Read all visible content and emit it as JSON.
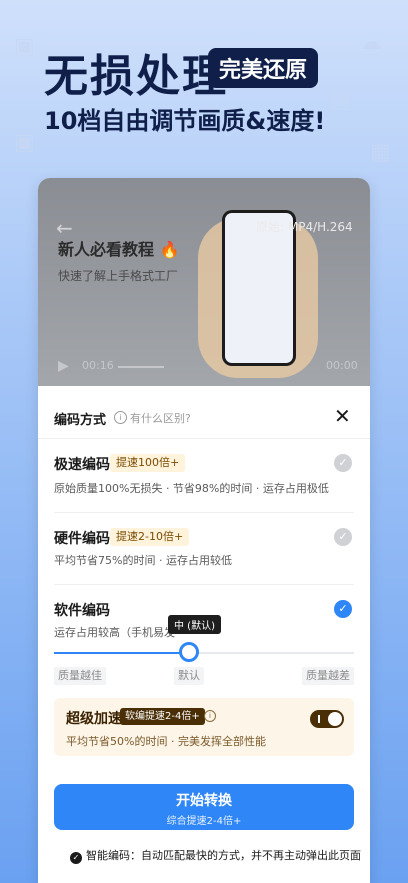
{
  "hero": {
    "title": "无损处理",
    "badge": "完美还原",
    "subtitle": "10档自由调节画质&速度!"
  },
  "video": {
    "title": "新人必看教程 🔥",
    "subtitle": "快速了解上手格式工厂",
    "meta": "原始: MP4/H.264",
    "time_current": "00:16",
    "time_total": "00:00"
  },
  "sheet": {
    "title": "编码方式",
    "hint": "有什么区别?",
    "options": [
      {
        "title": "极速编码",
        "tag": "提速100倍+",
        "desc": "原始质量100%无损失 · 节省98%的时间 · 运存占用极低",
        "selected": false
      },
      {
        "title": "硬件编码",
        "tag": "提速2-10倍+",
        "desc": "平均节省75%的时间 · 运存占用较低",
        "selected": false
      },
      {
        "title": "软件编码",
        "tag": "",
        "desc": "运存占用较高（手机易发",
        "selected": true
      }
    ],
    "slider": {
      "tooltip": "中 (默认)",
      "labels": [
        "质量越佳",
        "默认",
        "质量越差"
      ],
      "value_fraction": 0.45
    },
    "boost": {
      "title": "超级加速",
      "tag": "软编提速2-4倍+",
      "desc": "平均节省50%的时间 · 完美发挥全部性能",
      "enabled": true
    },
    "start_button": {
      "label": "开始转换",
      "sub": "综合提速2-4倍+"
    },
    "smart": "智能编码：自动匹配最快的方式，并不再主动弹出此页面"
  }
}
